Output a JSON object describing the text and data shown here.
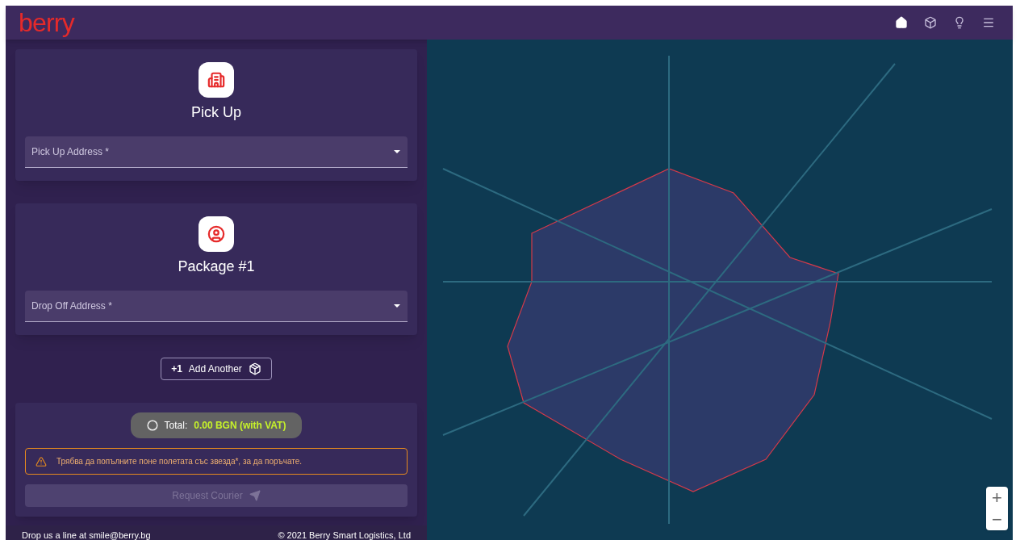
{
  "header": {
    "logo": "berry",
    "nav": [
      {
        "kind": "home",
        "selected": true
      },
      {
        "kind": "box",
        "selected": false
      },
      {
        "kind": "bulb",
        "selected": false
      },
      {
        "kind": "menu",
        "selected": false
      }
    ]
  },
  "sections": [
    {
      "kind": "building",
      "title": "Pick Up",
      "field": {
        "placeholder": "Pick Up Address *"
      }
    },
    {
      "kind": "person",
      "title": "Package #1",
      "field": {
        "placeholder": "Drop Off Address *"
      }
    }
  ],
  "add_button": {
    "prefix": "+1",
    "label": "Add Another"
  },
  "summary": {
    "total_label": "Total:",
    "total_value": "0.00 BGN (with VAT)",
    "warning": "Трябва да попълните поне полетата със звезда*, за да поръчате.",
    "submit": {
      "label": "Request Courier",
      "disabled": true
    }
  },
  "map": {
    "zoom": [
      "+",
      "−"
    ]
  },
  "footer": {
    "contact": "Drop us a line at smile@berry.bg",
    "copyright": "© 2021 Berry Smart Logistics, Ltd"
  }
}
